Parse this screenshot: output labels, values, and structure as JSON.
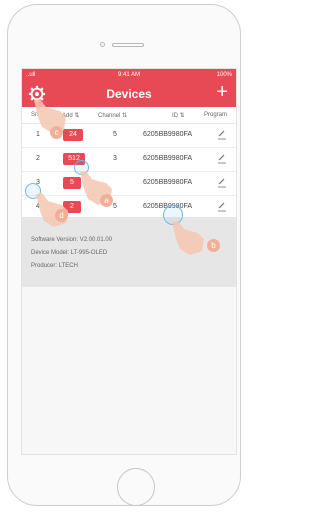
{
  "status_bar": {
    "signal": "..ull",
    "time": "9:41 AM",
    "battery": "100%"
  },
  "nav": {
    "title": "Devices",
    "add_label": "+"
  },
  "columns": {
    "sn": "Sn",
    "address": "Add ⇅",
    "channel": "Channel ⇅",
    "id": "ID ⇅",
    "program": "Program"
  },
  "rows": [
    {
      "sn": "1",
      "address": "24",
      "channel": "5",
      "id": "6205BB9980FA"
    },
    {
      "sn": "2",
      "address": "512",
      "channel": "3",
      "id": "6205BB9980FA"
    },
    {
      "sn": "3",
      "address": "5",
      "channel": "",
      "id": "6205BB9980FA"
    },
    {
      "sn": "4",
      "address": "2",
      "channel": "5",
      "id": "6205BB9980FA"
    }
  ],
  "info": {
    "software": "Software Version:  V2.00.01.00",
    "model": "Device Model:  LT-995-OLED",
    "producer": "Producer:  LTECH"
  },
  "callouts": {
    "a": "a",
    "b": "b",
    "c": "c",
    "d": "d"
  },
  "colors": {
    "accent": "#e84a55",
    "touch": "#6fb9ea",
    "hand": "#f0b098"
  }
}
